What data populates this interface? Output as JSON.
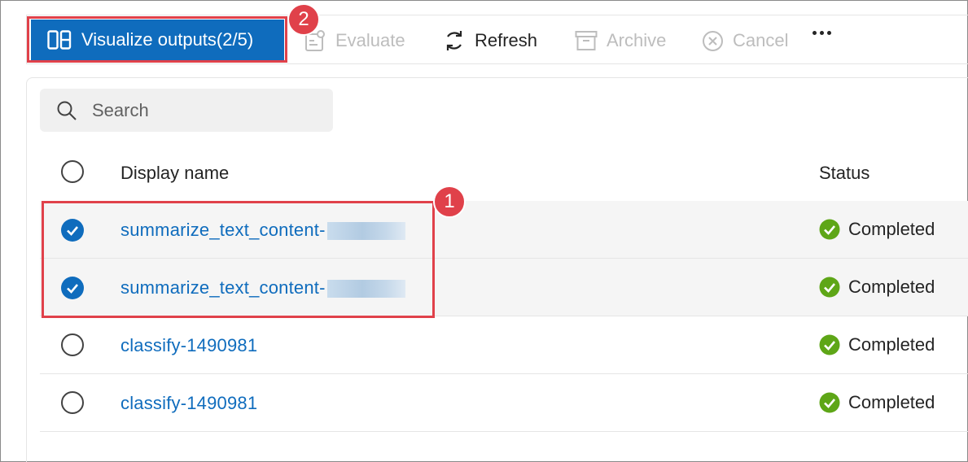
{
  "toolbar": {
    "visualize_label": "Visualize outputs(2/5)",
    "evaluate_label": "Evaluate",
    "refresh_label": "Refresh",
    "archive_label": "Archive",
    "cancel_label": "Cancel",
    "more_icon": "more-horizontal-icon"
  },
  "search": {
    "placeholder": "Search"
  },
  "table": {
    "columns": {
      "display_name": "Display name",
      "status": "Status"
    },
    "rows": [
      {
        "name": "summarize_text_content-",
        "status": "Completed",
        "selected": true
      },
      {
        "name": "summarize_text_content-",
        "status": "Completed",
        "selected": true
      },
      {
        "name": "classify-1490981",
        "status": "Completed",
        "selected": false
      },
      {
        "name": "classify-1490981",
        "status": "Completed",
        "selected": false
      }
    ]
  },
  "annotations": {
    "badge_1": "1",
    "badge_2": "2"
  },
  "colors": {
    "accent": "#0f6cbd",
    "success": "#5ea617",
    "annotation": "#e0414a"
  }
}
